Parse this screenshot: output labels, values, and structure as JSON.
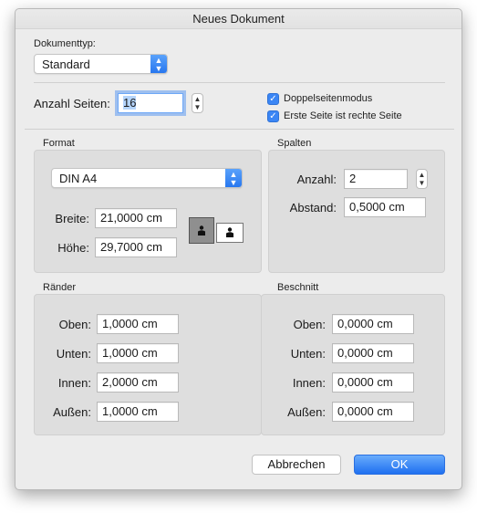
{
  "window": {
    "title": "Neues Dokument"
  },
  "doc_type": {
    "label": "Dokumenttyp:",
    "value": "Standard"
  },
  "pages": {
    "label": "Anzahl Seiten:",
    "value": "16"
  },
  "options": {
    "double_sided": {
      "label": "Doppelseitenmodus",
      "checked": true
    },
    "first_page_right": {
      "label": "Erste Seite ist rechte Seite",
      "checked": true
    }
  },
  "format": {
    "title": "Format",
    "paper": "DIN A4",
    "width_label": "Breite:",
    "width_value": "21,0000 cm",
    "height_label": "Höhe:",
    "height_value": "29,7000 cm",
    "orientation": "portrait"
  },
  "columns": {
    "title": "Spalten",
    "count_label": "Anzahl:",
    "count_value": "2",
    "gap_label": "Abstand:",
    "gap_value": "0,5000 cm"
  },
  "margins": {
    "title": "Ränder",
    "rows": [
      {
        "label": "Oben:",
        "value": "1,0000 cm"
      },
      {
        "label": "Unten:",
        "value": "1,0000 cm"
      },
      {
        "label": "Innen:",
        "value": "2,0000 cm"
      },
      {
        "label": "Außen:",
        "value": "1,0000 cm"
      }
    ]
  },
  "bleed": {
    "title": "Beschnitt",
    "rows": [
      {
        "label": "Oben:",
        "value": "0,0000 cm"
      },
      {
        "label": "Unten:",
        "value": "0,0000 cm"
      },
      {
        "label": "Innen:",
        "value": "0,0000 cm"
      },
      {
        "label": "Außen:",
        "value": "0,0000 cm"
      }
    ]
  },
  "buttons": {
    "cancel": "Abbrechen",
    "ok": "OK"
  },
  "icons": {
    "popup_arrows": "⌃⌄",
    "checkmark": "✓",
    "page_person": "person-icon"
  },
  "colors": {
    "accent": "#2777ef",
    "group_bg": "#dedede",
    "dialog_bg": "#ececec"
  }
}
